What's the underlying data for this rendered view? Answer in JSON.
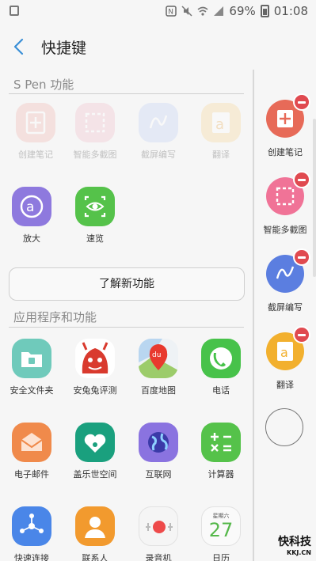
{
  "status": {
    "battery": "69%",
    "time": "01:08"
  },
  "header": {
    "title": "快捷键"
  },
  "spen": {
    "section_title": "S Pen 功能",
    "apps": [
      {
        "label": "创建笔记",
        "icon": "note-plus-icon",
        "color": "#f0a9a3"
      },
      {
        "label": "智能多截图",
        "icon": "crop-icon",
        "color": "#f1b4c3"
      },
      {
        "label": "截屏编写",
        "icon": "screen-write-icon",
        "color": "#b6c8f3"
      },
      {
        "label": "翻译",
        "icon": "translate-icon",
        "color": "#f6cf86"
      },
      {
        "label": "放大",
        "icon": "magnifier-icon",
        "color": "#8e79de"
      },
      {
        "label": "速览",
        "icon": "glance-eye-icon",
        "color": "#55c24a"
      }
    ]
  },
  "learn_button": "了解新功能",
  "apps_section": {
    "title": "应用程序和功能",
    "apps": [
      {
        "label": "安全文件夹",
        "icon": "secure-folder-icon",
        "color": "#6fcabb"
      },
      {
        "label": "安兔兔评测",
        "icon": "antutu-icon",
        "color": "#ffffff"
      },
      {
        "label": "百度地图",
        "icon": "baidu-map-icon",
        "color": "#eef2f5"
      },
      {
        "label": "电话",
        "icon": "phone-icon",
        "color": "#47c24a"
      },
      {
        "label": "电子邮件",
        "icon": "email-icon",
        "color": "#f08a4b"
      },
      {
        "label": "盖乐世空间",
        "icon": "galaxy-space-icon",
        "color": "#1aa07e"
      },
      {
        "label": "互联网",
        "icon": "internet-globe-icon",
        "color": "#8a73e0"
      },
      {
        "label": "计算器",
        "icon": "calculator-icon",
        "color": "#55c24a"
      },
      {
        "label": "快速连接",
        "icon": "quick-connect-icon",
        "color": "#4a86e8"
      },
      {
        "label": "联系人",
        "icon": "contacts-icon",
        "color": "#f29a2e"
      },
      {
        "label": "录音机",
        "icon": "recorder-icon",
        "color": "#f5f5f5"
      },
      {
        "label": "日历",
        "icon": "calendar-icon",
        "color": "#fafafa",
        "day_label": "星期六",
        "date": "27"
      }
    ]
  },
  "sidebar": {
    "items": [
      {
        "label": "创建笔记",
        "icon": "note-plus-icon",
        "color": "#e76a58"
      },
      {
        "label": "智能多截图",
        "icon": "crop-icon",
        "color": "#f07397"
      },
      {
        "label": "截屏编写",
        "icon": "screen-write-icon",
        "color": "#5b7ee0"
      },
      {
        "label": "翻译",
        "icon": "translate-icon",
        "color": "#f2b02e"
      }
    ]
  },
  "watermark": {
    "title": "快科技",
    "sub": "KKJ.CN"
  }
}
